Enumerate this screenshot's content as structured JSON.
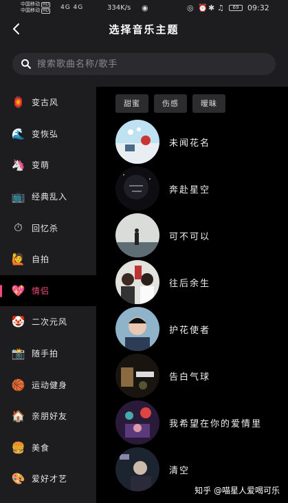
{
  "status_bar": {
    "carrier1": "中国移动",
    "carrier2": "中国移动",
    "hd": "HD",
    "network": "4G 4G",
    "speed": "334K/s",
    "battery": "69",
    "time": "09:32"
  },
  "header": {
    "title": "选择音乐主题"
  },
  "search": {
    "placeholder": "搜索歌曲名称/歌手"
  },
  "sidebar": {
    "items": [
      {
        "label": "变古风",
        "icon": "lantern-icon",
        "emoji": "🏮"
      },
      {
        "label": "变恢弘",
        "icon": "wave-icon",
        "emoji": "🌊"
      },
      {
        "label": "变萌",
        "icon": "unicorn-icon",
        "emoji": "🦄"
      },
      {
        "label": "经典乱入",
        "icon": "tv-icon",
        "emoji": "📺"
      },
      {
        "label": "回忆杀",
        "icon": "stopwatch-icon",
        "emoji": "⏱"
      },
      {
        "label": "自拍",
        "icon": "face-icon",
        "emoji": "🙋"
      },
      {
        "label": "情侣",
        "icon": "heart-icon",
        "emoji": "💖"
      },
      {
        "label": "二次元风",
        "icon": "clown-icon",
        "emoji": "🤡"
      },
      {
        "label": "随手拍",
        "icon": "camera-icon",
        "emoji": "📸"
      },
      {
        "label": "运动健身",
        "icon": "basketball-icon",
        "emoji": "🏀"
      },
      {
        "label": "亲朋好友",
        "icon": "house-icon",
        "emoji": "🏠"
      },
      {
        "label": "美食",
        "icon": "burger-icon",
        "emoji": "🍔"
      },
      {
        "label": "爱好才艺",
        "icon": "palette-icon",
        "emoji": "🎨"
      }
    ],
    "active_index": 6
  },
  "tags": [
    "甜蜜",
    "伤感",
    "暧昧"
  ],
  "songs": [
    {
      "name": "未闻花名"
    },
    {
      "name": "奔赴星空"
    },
    {
      "name": "可不可以"
    },
    {
      "name": "往后余生"
    },
    {
      "name": "护花使者"
    },
    {
      "name": "告白气球"
    },
    {
      "name": "我希望在你的爱情里"
    },
    {
      "name": "清空"
    }
  ],
  "watermark": "知乎 @喵星人爱喝可乐",
  "colors": {
    "accent": "#f04a7a",
    "background": "#000000",
    "panel": "#1d1d1f"
  }
}
